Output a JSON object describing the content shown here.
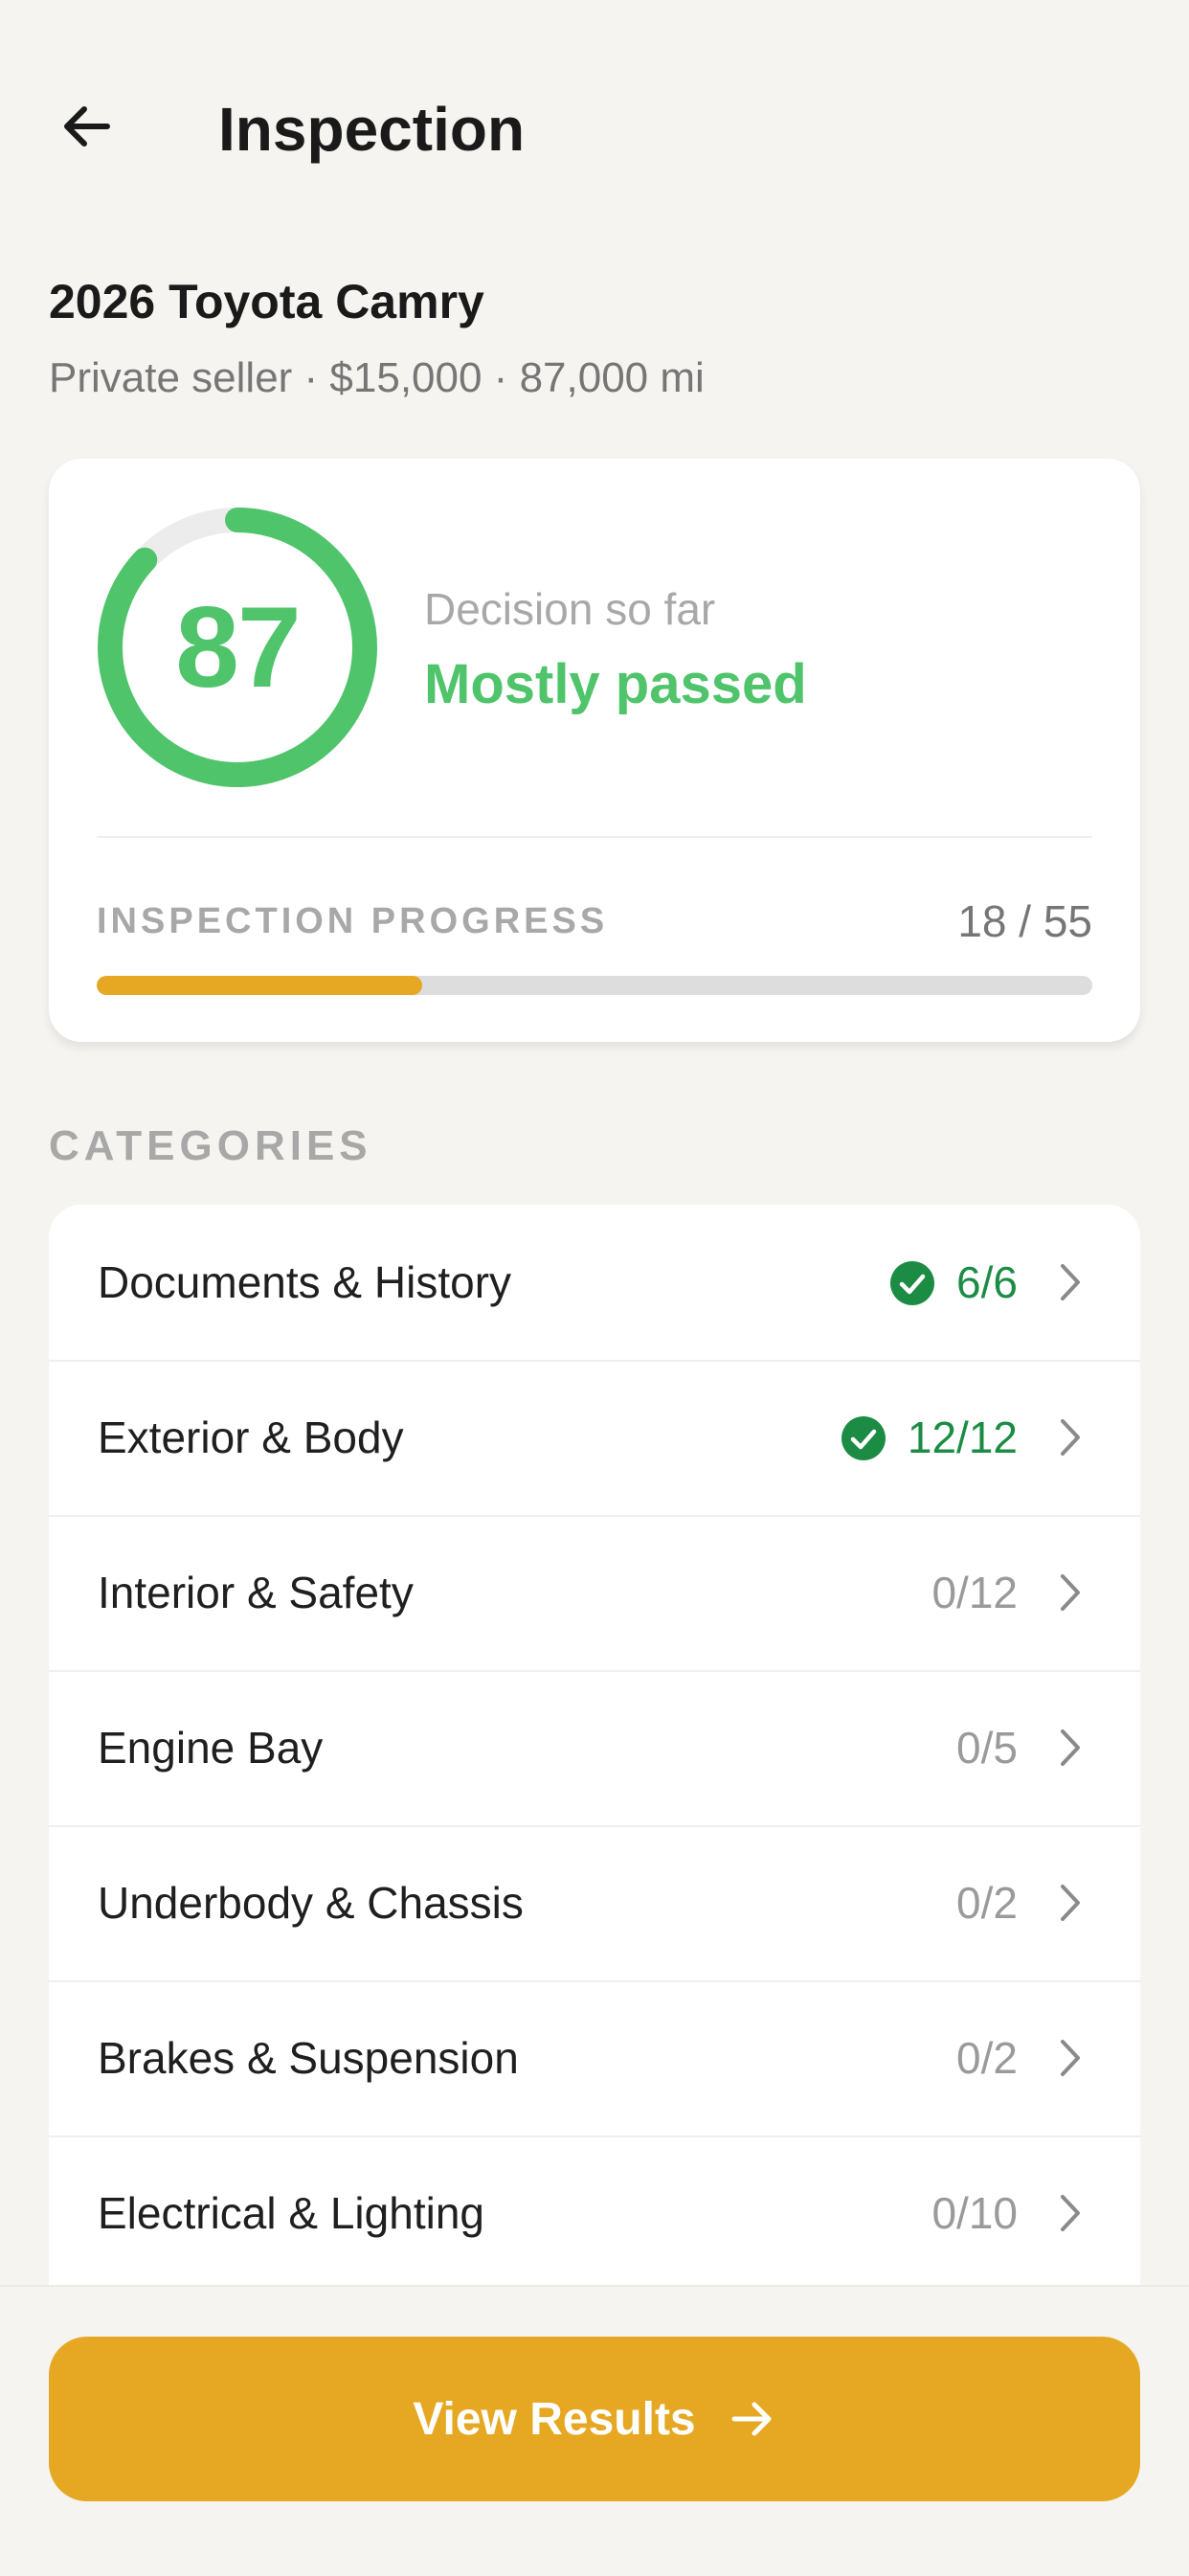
{
  "header": {
    "title": "Inspection",
    "back_icon": "arrow-left-icon"
  },
  "vehicle": {
    "name": "2026 Toyota Camry",
    "meta": "Private seller · $15,000 · 87,000 mi"
  },
  "summary": {
    "score": "87",
    "score_fraction": 0.87,
    "decision_label": "Decision so far",
    "decision_value": "Mostly passed",
    "progress_label": "INSPECTION PROGRESS",
    "progress_text": "18 / 55",
    "progress_fraction": 0.327
  },
  "categories_title": "CATEGORIES",
  "categories": [
    {
      "name": "Documents & History",
      "count": "6/6",
      "complete": true
    },
    {
      "name": "Exterior & Body",
      "count": "12/12",
      "complete": true
    },
    {
      "name": "Interior & Safety",
      "count": "0/12",
      "complete": false
    },
    {
      "name": "Engine Bay",
      "count": "0/5",
      "complete": false
    },
    {
      "name": "Underbody & Chassis",
      "count": "0/2",
      "complete": false
    },
    {
      "name": "Brakes & Suspension",
      "count": "0/2",
      "complete": false
    },
    {
      "name": "Electrical & Lighting",
      "count": "0/10",
      "complete": false
    }
  ],
  "footer": {
    "button_label": "View Results",
    "button_icon": "arrow-right-icon"
  },
  "colors": {
    "accent": "#e6a823",
    "success": "#4fc46b",
    "success_dark": "#1c8c45",
    "background": "#f5f4f1"
  }
}
